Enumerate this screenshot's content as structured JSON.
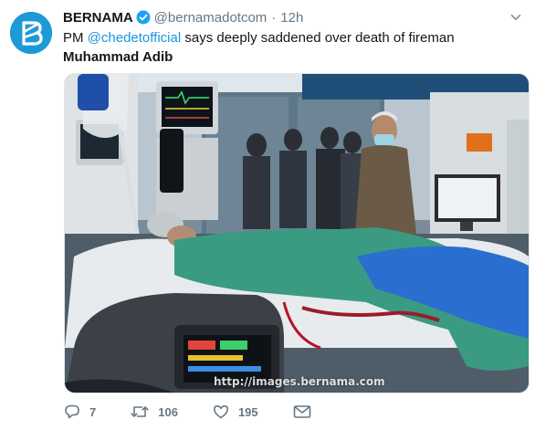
{
  "tweet": {
    "author_name": "BERNAMA",
    "handle": "@bernamadotcom",
    "separator": "·",
    "time": "12h",
    "text_prefix": "PM ",
    "mention": "@chedetofficial",
    "text_middle": " says deeply saddened over death of fireman ",
    "text_bold": "Muhammad Adib",
    "photo_watermark": "http://images.bernama.com",
    "reply_count": "7",
    "retweet_count": "106",
    "like_count": "195",
    "accent_color": "#1da1f2",
    "icons": {
      "avatar": "bernama-logo-icon",
      "verified": "verified-badge-icon",
      "menu": "chevron-down-icon",
      "reply": "reply-icon",
      "retweet": "retweet-icon",
      "like": "heart-icon",
      "dm": "envelope-icon"
    }
  }
}
